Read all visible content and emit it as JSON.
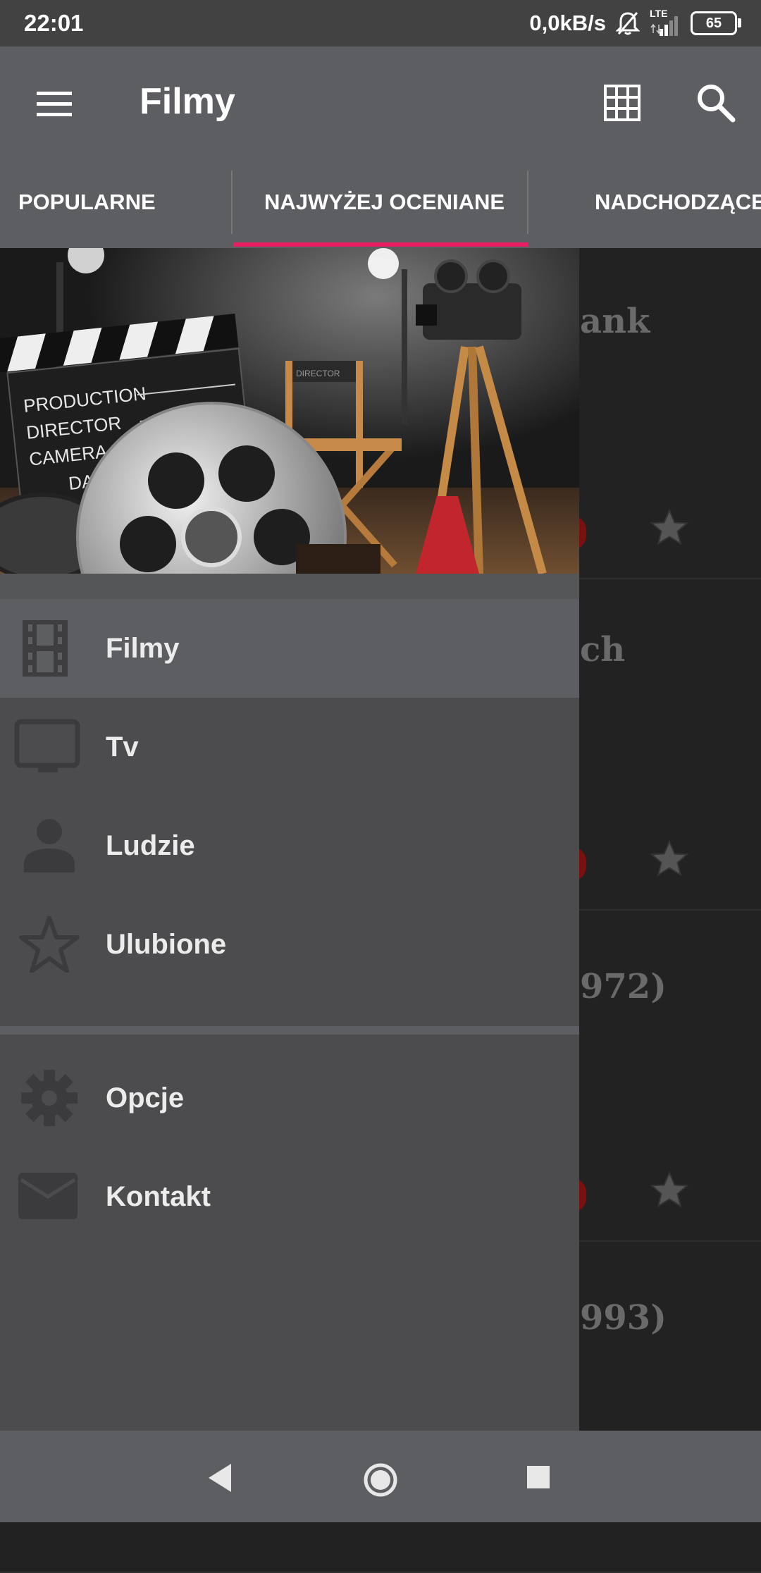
{
  "status_bar": {
    "time": "22:01",
    "net_speed": "0,0kB/s",
    "network_type": "LTE",
    "battery": "65",
    "icons": [
      "bell-off-icon",
      "signal-icon",
      "battery-icon"
    ]
  },
  "toolbar": {
    "title": "Filmy",
    "icons": [
      "menu-icon",
      "grid-view-icon",
      "search-icon"
    ]
  },
  "tabs": {
    "items": [
      {
        "label": "POPULARNE"
      },
      {
        "label": "NAJWYŻEJ OCENIANE"
      },
      {
        "label": "NADCHODZĄCE"
      }
    ],
    "selected_index": 1,
    "indicator_color": "#e91e63"
  },
  "background_list": {
    "partial_titles": [
      "ank",
      "ch",
      "972)",
      "993)"
    ],
    "icons": [
      "star-icon"
    ]
  },
  "drawer": {
    "header_image": "film-clapperboard-reel-director-chair-camera",
    "header_image_text": [
      "PRODUCTION",
      "DIRECTOR",
      "CAMERA",
      "DATE",
      "DIRECTOR"
    ],
    "items": [
      {
        "label": "Filmy",
        "icon": "movie-film-icon",
        "selected": true
      },
      {
        "label": "Tv",
        "icon": "tv-icon",
        "selected": false
      },
      {
        "label": "Ludzie",
        "icon": "person-icon",
        "selected": false
      },
      {
        "label": "Ulubione",
        "icon": "star-outline-icon",
        "selected": false
      }
    ],
    "secondary_items": [
      {
        "label": "Opcje",
        "icon": "gear-icon"
      },
      {
        "label": "Kontakt",
        "icon": "mail-icon"
      }
    ]
  },
  "nav_bar": {
    "icons": [
      "back-icon",
      "home-icon",
      "recents-icon"
    ]
  },
  "colors": {
    "app_bar": "#5d5e62",
    "drawer": "#4c4c4e",
    "accent": "#e91e63",
    "status_bar": "#424242"
  }
}
